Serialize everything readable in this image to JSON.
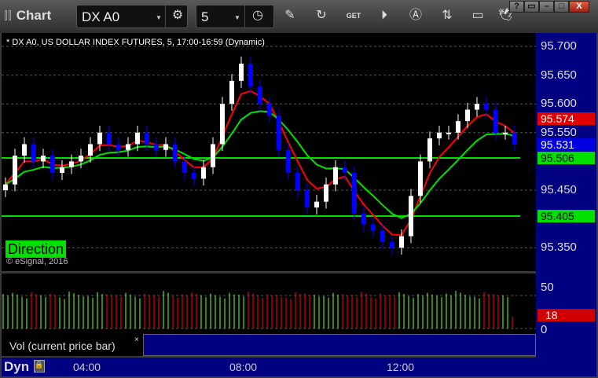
{
  "window": {
    "title": "Chart",
    "buttons": [
      "?",
      "▭",
      "–",
      "□",
      "X"
    ]
  },
  "toolbar": {
    "symbol": "DX A0",
    "interval": "5",
    "icons": [
      "settings-icon",
      "clock-icon",
      "pencil-icon",
      "refresh-chart-icon",
      "get-icon",
      "play-icon",
      "alert-icon",
      "link-icon",
      "comment-icon",
      "twitter-icon"
    ]
  },
  "chart": {
    "subtitle": "* DX A0, US DOLLAR INDEX FUTURES, 5, 17:00-16:59 (Dynamic)",
    "direction_label": "Direction",
    "copyright": "© eSignal, 2016",
    "price_labels": [
      "95.700",
      "95.650",
      "95.600",
      "95.550",
      "95.450",
      "95.350"
    ],
    "tags": [
      {
        "text": "95.574",
        "bg": "#e00000",
        "fg": "#ffffff"
      },
      {
        "text": "95.531",
        "bg": "#0000e0",
        "fg": "#ffffff"
      },
      {
        "text": "95.506",
        "bg": "#00e000",
        "fg": "#000000"
      },
      {
        "text": "95.405",
        "bg": "#00e000",
        "fg": "#000000"
      }
    ]
  },
  "chart_data": {
    "type": "candlestick",
    "ylim": [
      95.33,
      95.72
    ],
    "closes": [
      95.46,
      95.51,
      95.53,
      95.5,
      95.51,
      95.48,
      95.49,
      95.5,
      95.51,
      95.53,
      95.55,
      95.53,
      95.52,
      95.53,
      95.55,
      95.53,
      95.52,
      95.53,
      95.5,
      95.48,
      95.47,
      95.49,
      95.53,
      95.6,
      95.64,
      95.67,
      95.63,
      95.6,
      95.58,
      95.52,
      95.48,
      95.45,
      95.42,
      95.43,
      95.46,
      95.49,
      95.48,
      95.41,
      95.39,
      95.38,
      95.36,
      95.35,
      95.37,
      95.44,
      95.5,
      95.54,
      95.55,
      95.55,
      95.57,
      95.59,
      95.6,
      95.59,
      95.55,
      95.55,
      95.53
    ],
    "levels": [
      95.506,
      95.405
    ],
    "colors": {
      "up": "#ffffff",
      "down": "#0000ff",
      "fast_ma": "#ff0000",
      "slow_ma": "#00e000"
    }
  },
  "volume": {
    "labels": [
      "50",
      "0"
    ],
    "current": "18",
    "legend": "Vol (current price bar)",
    "close": "×",
    "values": [
      52,
      54,
      48,
      55,
      50,
      53,
      47,
      56,
      51,
      49,
      55,
      52,
      50,
      54,
      48,
      53,
      51,
      57,
      49,
      52,
      55,
      50,
      53,
      48,
      54,
      51,
      56,
      49,
      52,
      50,
      47,
      55,
      53,
      51,
      49,
      54,
      52,
      50,
      56,
      48,
      53,
      51,
      55,
      49,
      52,
      54,
      50,
      53,
      57,
      51,
      48,
      55,
      52,
      50,
      18
    ],
    "colors": {
      "up": "#60e020",
      "down": "#e00000"
    }
  },
  "bottom": {
    "mode": "Dyn",
    "times": [
      "04:00",
      "08:00",
      "12:00"
    ]
  }
}
